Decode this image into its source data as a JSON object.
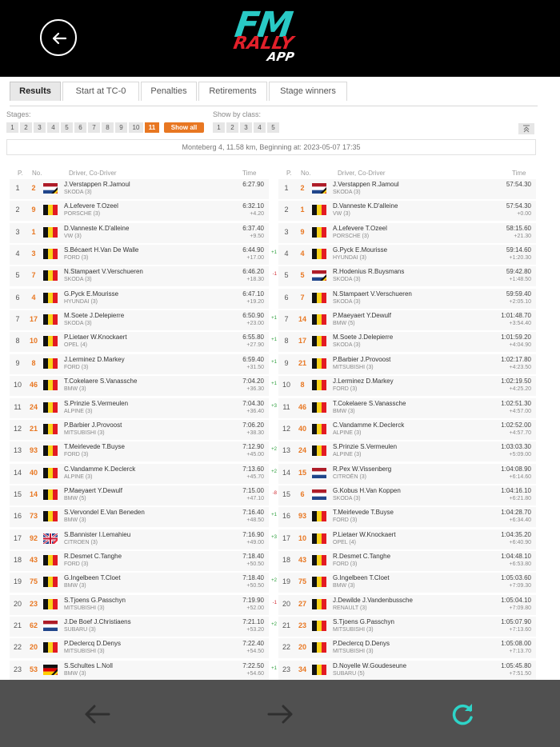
{
  "app": {
    "logo_text": "FM RALLY APP"
  },
  "tabs": [
    {
      "label": "Results",
      "active": true
    },
    {
      "label": "Start at TC-0"
    },
    {
      "label": "Penalties"
    },
    {
      "label": "Retirements"
    },
    {
      "label": "Stage winners"
    }
  ],
  "filters": {
    "stages_label": "Stages:",
    "stages": [
      "1",
      "2",
      "3",
      "4",
      "5",
      "6",
      "7",
      "8",
      "9",
      "10",
      "11"
    ],
    "selected_stage": "11",
    "show_all_label": "Show all",
    "class_label": "Show by class:",
    "classes": [
      "1",
      "2",
      "3",
      "4",
      "5"
    ]
  },
  "stage_info": "Monteberg 4, 11.58 km, Beginning at: 2023-05-07 17:35",
  "columns": {
    "pos": "P.",
    "num": "No.",
    "crew": "Driver, Co-Driver",
    "time": "Time"
  },
  "colors": {
    "accent": "#e87722",
    "up": "#2a9d3a",
    "down": "#d0262e",
    "refresh": "#2ed4c8"
  },
  "stage_results": [
    {
      "pos": "1",
      "num": "2",
      "flag": "nl-be",
      "crew": "J.Verstappen R.Jamoul",
      "car": "SKODA (3)",
      "time": "6:27.90",
      "diff": ""
    },
    {
      "pos": "2",
      "num": "9",
      "flag": "be",
      "crew": "A.Lefevere T.Ozeel",
      "car": "PORSCHE (3)",
      "time": "6:32.10",
      "diff": "+4.20"
    },
    {
      "pos": "3",
      "num": "1",
      "flag": "be",
      "crew": "D.Vanneste K.D'alleine",
      "car": "VW (3)",
      "time": "6:37.40",
      "diff": "+9.50"
    },
    {
      "pos": "4",
      "num": "3",
      "flag": "be",
      "crew": "S.Bécaert H.Van De Walle",
      "car": "FORD (3)",
      "time": "6:44.90",
      "diff": "+17.00"
    },
    {
      "pos": "5",
      "num": "7",
      "flag": "be",
      "crew": "N.Stampaert V.Verschueren",
      "car": "SKODA (3)",
      "time": "6:46.20",
      "diff": "+18.30"
    },
    {
      "pos": "6",
      "num": "4",
      "flag": "be",
      "crew": "G.Pyck E.Mourisse",
      "car": "HYUNDAI (3)",
      "time": "6:47.10",
      "diff": "+19.20"
    },
    {
      "pos": "7",
      "num": "17",
      "flag": "be",
      "crew": "M.Soete J.Delepierre",
      "car": "SKODA (3)",
      "time": "6:50.90",
      "diff": "+23.00"
    },
    {
      "pos": "8",
      "num": "10",
      "flag": "be",
      "crew": "P.Lietaer W.Knockaert",
      "car": "OPEL (4)",
      "time": "6:55.80",
      "diff": "+27.90"
    },
    {
      "pos": "9",
      "num": "8",
      "flag": "be",
      "crew": "J.Lerminez D.Markey",
      "car": "FORD (3)",
      "time": "6:59.40",
      "diff": "+31.50"
    },
    {
      "pos": "10",
      "num": "46",
      "flag": "be",
      "crew": "T.Cokelaere S.Vanassche",
      "car": "BMW (3)",
      "time": "7:04.20",
      "diff": "+36.30"
    },
    {
      "pos": "11",
      "num": "24",
      "flag": "be",
      "crew": "S.Prinzie S.Vermeulen",
      "car": "ALPINE (3)",
      "time": "7:04.30",
      "diff": "+36.40"
    },
    {
      "pos": "12",
      "num": "21",
      "flag": "be",
      "crew": "P.Barbier J.Provoost",
      "car": "MITSUBISHI (3)",
      "time": "7:06.20",
      "diff": "+38.30"
    },
    {
      "pos": "13",
      "num": "93",
      "flag": "be",
      "crew": "T.Meirlevede T.Buyse",
      "car": "FORD (3)",
      "time": "7:12.90",
      "diff": "+45.00"
    },
    {
      "pos": "14",
      "num": "40",
      "flag": "be",
      "crew": "C.Vandamme K.Declerck",
      "car": "ALPINE (3)",
      "time": "7:13.60",
      "diff": "+45.70"
    },
    {
      "pos": "15",
      "num": "14",
      "flag": "be",
      "crew": "P.Maeyaert Y.Dewulf",
      "car": "BMW (5)",
      "time": "7:15.00",
      "diff": "+47.10"
    },
    {
      "pos": "16",
      "num": "73",
      "flag": "be",
      "crew": "S.Vervondel E.Van Beneden",
      "car": "BMW (3)",
      "time": "7:16.40",
      "diff": "+48.50"
    },
    {
      "pos": "17",
      "num": "92",
      "flag": "gb-fr",
      "crew": "S.Bannister I.Lemahieu",
      "car": "CITROEN (3)",
      "time": "7:16.90",
      "diff": "+49.00"
    },
    {
      "pos": "18",
      "num": "43",
      "flag": "be",
      "crew": "R.Desmet C.Tanghe",
      "car": "FORD (3)",
      "time": "7:18.40",
      "diff": "+50.50"
    },
    {
      "pos": "19",
      "num": "75",
      "flag": "be",
      "crew": "G.Ingelbeen T.Cloet",
      "car": "BMW (3)",
      "time": "7:18.40",
      "diff": "+50.50"
    },
    {
      "pos": "20",
      "num": "23",
      "flag": "be",
      "crew": "S.Tjoens G.Passchyn",
      "car": "MITSUBISHI (3)",
      "time": "7:19.90",
      "diff": "+52.00"
    },
    {
      "pos": "21",
      "num": "62",
      "flag": "nl",
      "crew": "J.De Boef J.Christiaens",
      "car": "SUBARU (3)",
      "time": "7:21.10",
      "diff": "+53.20"
    },
    {
      "pos": "22",
      "num": "20",
      "flag": "be",
      "crew": "P.Declercq D.Denys",
      "car": "MITSUBISHI (3)",
      "time": "7:22.40",
      "diff": "+54.50"
    },
    {
      "pos": "23",
      "num": "53",
      "flag": "de-be",
      "crew": "S.Schultes L.Noll",
      "car": "BMW (3)",
      "time": "7:22.50",
      "diff": "+54.60"
    }
  ],
  "overall_results": [
    {
      "pos": "1",
      "num": "2",
      "flag": "nl-be",
      "crew": "J.Verstappen R.Jamoul",
      "car": "SKODA (3)",
      "time": "57:54.30",
      "diff": "",
      "change": "",
      "dir": ""
    },
    {
      "pos": "2",
      "num": "1",
      "flag": "be",
      "crew": "D.Vanneste K.D'alleine",
      "car": "VW (3)",
      "time": "57:54.30",
      "diff": "+0.00",
      "change": "",
      "dir": ""
    },
    {
      "pos": "3",
      "num": "9",
      "flag": "be",
      "crew": "A.Lefevere T.Ozeel",
      "car": "PORSCHE (3)",
      "time": "58:15.60",
      "diff": "+21.30",
      "change": "",
      "dir": ""
    },
    {
      "pos": "4",
      "num": "4",
      "flag": "be",
      "crew": "G.Pyck E.Mourisse",
      "car": "HYUNDAI (3)",
      "time": "59:14.60",
      "diff": "+1:20.30",
      "change": "+1",
      "dir": "up"
    },
    {
      "pos": "5",
      "num": "5",
      "flag": "nl-be",
      "crew": "R.Hodenius R.Buysmans",
      "car": "SKODA (3)",
      "time": "59:42.80",
      "diff": "+1:48.50",
      "change": "-1",
      "dir": "down"
    },
    {
      "pos": "6",
      "num": "7",
      "flag": "be",
      "crew": "N.Stampaert V.Verschueren",
      "car": "SKODA (3)",
      "time": "59:59.40",
      "diff": "+2:05.10",
      "change": "",
      "dir": ""
    },
    {
      "pos": "7",
      "num": "14",
      "flag": "be",
      "crew": "P.Maeyaert Y.Dewulf",
      "car": "BMW (5)",
      "time": "1:01:48.70",
      "diff": "+3:54.40",
      "change": "+1",
      "dir": "up"
    },
    {
      "pos": "8",
      "num": "17",
      "flag": "be",
      "crew": "M.Soete J.Delepierre",
      "car": "SKODA (3)",
      "time": "1:01:59.20",
      "diff": "+4:04.90",
      "change": "+1",
      "dir": "up"
    },
    {
      "pos": "9",
      "num": "21",
      "flag": "be",
      "crew": "P.Barbier J.Provoost",
      "car": "MITSUBISHI (3)",
      "time": "1:02:17.80",
      "diff": "+4:23.50",
      "change": "+1",
      "dir": "up"
    },
    {
      "pos": "10",
      "num": "8",
      "flag": "be",
      "crew": "J.Lerminez D.Markey",
      "car": "FORD (3)",
      "time": "1:02:19.50",
      "diff": "+4:25.20",
      "change": "+1",
      "dir": "up"
    },
    {
      "pos": "11",
      "num": "46",
      "flag": "be",
      "crew": "T.Cokelaere S.Vanassche",
      "car": "BMW (3)",
      "time": "1:02:51.30",
      "diff": "+4:57.00",
      "change": "+3",
      "dir": "up"
    },
    {
      "pos": "12",
      "num": "40",
      "flag": "be",
      "crew": "C.Vandamme K.Declerck",
      "car": "ALPINE (3)",
      "time": "1:02:52.00",
      "diff": "+4:57.70",
      "change": "",
      "dir": ""
    },
    {
      "pos": "13",
      "num": "24",
      "flag": "be",
      "crew": "S.Prinzie S.Vermeulen",
      "car": "ALPINE (3)",
      "time": "1:03:03.30",
      "diff": "+5:09.00",
      "change": "+2",
      "dir": "up"
    },
    {
      "pos": "14",
      "num": "15",
      "flag": "nl",
      "crew": "R.Pex W.Vissenberg",
      "car": "CITROËN (3)",
      "time": "1:04:08.90",
      "diff": "+6:14.60",
      "change": "+2",
      "dir": "up"
    },
    {
      "pos": "15",
      "num": "6",
      "flag": "nl",
      "crew": "G.Kobus H.Van Koppen",
      "car": "SKODA (3)",
      "time": "1:04:16.10",
      "diff": "+6:21.80",
      "change": "-8",
      "dir": "down"
    },
    {
      "pos": "16",
      "num": "93",
      "flag": "be",
      "crew": "T.Meirlevede T.Buyse",
      "car": "FORD (3)",
      "time": "1:04:28.70",
      "diff": "+6:34.40",
      "change": "+1",
      "dir": "up"
    },
    {
      "pos": "17",
      "num": "10",
      "flag": "be",
      "crew": "P.Lietaer W.Knockaert",
      "car": "OPEL (4)",
      "time": "1:04:35.20",
      "diff": "+6:40.90",
      "change": "+3",
      "dir": "up"
    },
    {
      "pos": "18",
      "num": "43",
      "flag": "be",
      "crew": "R.Desmet C.Tanghe",
      "car": "FORD (3)",
      "time": "1:04:48.10",
      "diff": "+6:53.80",
      "change": "",
      "dir": ""
    },
    {
      "pos": "19",
      "num": "75",
      "flag": "be",
      "crew": "G.Ingelbeen T.Cloet",
      "car": "BMW (3)",
      "time": "1:05:03.60",
      "diff": "+7:09.30",
      "change": "+2",
      "dir": "up"
    },
    {
      "pos": "20",
      "num": "27",
      "flag": "be",
      "crew": "J.Dewilde J.Vandenbussche",
      "car": "RENAULT (3)",
      "time": "1:05:04.10",
      "diff": "+7:09.80",
      "change": "-1",
      "dir": "down"
    },
    {
      "pos": "21",
      "num": "23",
      "flag": "be",
      "crew": "S.Tjoens G.Passchyn",
      "car": "MITSUBISHI (3)",
      "time": "1:05:07.90",
      "diff": "+7:13.60",
      "change": "+2",
      "dir": "up"
    },
    {
      "pos": "22",
      "num": "20",
      "flag": "be",
      "crew": "P.Declercq D.Denys",
      "car": "MITSUBISHI (3)",
      "time": "1:05:08.00",
      "diff": "+7:13.70",
      "change": "",
      "dir": ""
    },
    {
      "pos": "23",
      "num": "34",
      "flag": "be",
      "crew": "D.Noyelle W.Goudeseune",
      "car": "SUBARU (5)",
      "time": "1:05:45.80",
      "diff": "+7:51.50",
      "change": "+1",
      "dir": "up"
    }
  ]
}
